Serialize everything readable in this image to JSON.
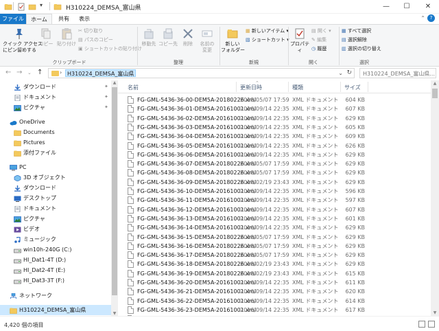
{
  "window": {
    "title": "H310224_DEMSA_富山県",
    "colors": {
      "accent": "#1979ca",
      "folder": "#f3c95c",
      "selection": "#cce8ff"
    }
  },
  "ribbon": {
    "tabs": {
      "file": "ファイル",
      "home": "ホーム",
      "share": "共有",
      "view": "表示"
    },
    "clipboard": {
      "pin_quick_access": "クイック アクセス\nにピン留めする",
      "copy": "コピー",
      "paste": "貼り付け",
      "cut": "切り取り",
      "copy_path": "パスのコピー",
      "paste_shortcut": "ショートカットの貼り付け",
      "label": "クリップボード"
    },
    "organize": {
      "move_to": "移動先",
      "copy_to": "コピー先",
      "delete": "削除",
      "rename": "名前の\n変更",
      "label": "整理"
    },
    "new": {
      "new_folder": "新しい\nフォルダー",
      "new_item": "新しいアイテム ▾",
      "easy_access": "ショートカット ▾",
      "label": "新規"
    },
    "open": {
      "properties": "プロパティ",
      "open": "開く ▾",
      "edit": "編集",
      "history": "履歴",
      "label": "開く"
    },
    "select": {
      "select_all": "すべて選択",
      "select_none": "選択解除",
      "invert": "選択の切り替え",
      "label": "選択"
    }
  },
  "address": {
    "path": "H310224_DEMSA_富山県",
    "search_placeholder": "H310224_DEMSA_富山県..."
  },
  "nav": {
    "items": [
      {
        "label": "ダウンロード",
        "icon": "download-icon",
        "pinned": true
      },
      {
        "label": "ドキュメント",
        "icon": "document-icon",
        "pinned": true
      },
      {
        "label": "ピクチャ",
        "icon": "picture-icon",
        "pinned": true
      },
      {
        "label": "OneDrive",
        "icon": "cloud-icon"
      },
      {
        "label": "Documents",
        "icon": "folder-icon"
      },
      {
        "label": "Pictures",
        "icon": "folder-icon"
      },
      {
        "label": "添付ファイル",
        "icon": "folder-icon"
      },
      {
        "label": "PC",
        "icon": "pc-icon"
      },
      {
        "label": "3D オブジェクト",
        "icon": "3d-objects-icon"
      },
      {
        "label": "ダウンロード",
        "icon": "download-icon"
      },
      {
        "label": "デスクトップ",
        "icon": "desktop-icon"
      },
      {
        "label": "ドキュメント",
        "icon": "document-icon"
      },
      {
        "label": "ピクチャ",
        "icon": "picture-icon"
      },
      {
        "label": "ビデオ",
        "icon": "video-icon"
      },
      {
        "label": "ミュージック",
        "icon": "music-icon"
      },
      {
        "label": "win10h-240G (C:)",
        "icon": "drive-icon"
      },
      {
        "label": "HI_Dat1-4T (D:)",
        "icon": "drive-icon"
      },
      {
        "label": "HI_Dat2-4T (E:)",
        "icon": "drive-icon"
      },
      {
        "label": "HI_Dat3-3T (F:)",
        "icon": "drive-icon"
      },
      {
        "label": "ネットワーク",
        "icon": "network-icon"
      },
      {
        "label": "H310224_DEMSA_富山県",
        "icon": "folder-icon",
        "selected": true
      }
    ]
  },
  "list": {
    "columns": {
      "name": "名前",
      "date": "更新日時",
      "type": "種類",
      "size": "サイズ"
    },
    "rows": [
      {
        "name": "FG-GML-5436-36-00-DEM5A-20180226.xml",
        "date": "2018/05/07 17:59",
        "type": "XML ドキュメント",
        "size": "604 KB"
      },
      {
        "name": "FG-GML-5436-36-01-DEM5A-20161001.xml",
        "date": "2016/09/14 22:35",
        "type": "XML ドキュメント",
        "size": "607 KB"
      },
      {
        "name": "FG-GML-5436-36-02-DEM5A-20161001.xml",
        "date": "2016/09/14 22:35",
        "type": "XML ドキュメント",
        "size": "629 KB"
      },
      {
        "name": "FG-GML-5436-36-03-DEM5A-20161001.xml",
        "date": "2016/09/14 22:35",
        "type": "XML ドキュメント",
        "size": "605 KB"
      },
      {
        "name": "FG-GML-5436-36-04-DEM5A-20161001.xml",
        "date": "2016/09/14 22:35",
        "type": "XML ドキュメント",
        "size": "609 KB"
      },
      {
        "name": "FG-GML-5436-36-05-DEM5A-20161001.xml",
        "date": "2016/09/14 22:35",
        "type": "XML ドキュメント",
        "size": "626 KB"
      },
      {
        "name": "FG-GML-5436-36-06-DEM5A-20161001.xml",
        "date": "2016/09/14 22:35",
        "type": "XML ドキュメント",
        "size": "629 KB"
      },
      {
        "name": "FG-GML-5436-36-07-DEM5A-20180226.xml",
        "date": "2018/05/07 17:59",
        "type": "XML ドキュメント",
        "size": "629 KB"
      },
      {
        "name": "FG-GML-5436-36-08-DEM5A-20180226.xml",
        "date": "2018/05/07 17:59",
        "type": "XML ドキュメント",
        "size": "629 KB"
      },
      {
        "name": "FG-GML-5436-36-09-DEM5A-20180226.xml",
        "date": "2018/02/19 23:43",
        "type": "XML ドキュメント",
        "size": "629 KB"
      },
      {
        "name": "FG-GML-5436-36-10-DEM5A-20161001.xml",
        "date": "2016/09/14 22:35",
        "type": "XML ドキュメント",
        "size": "596 KB"
      },
      {
        "name": "FG-GML-5436-36-11-DEM5A-20161001.xml",
        "date": "2016/09/14 22:35",
        "type": "XML ドキュメント",
        "size": "597 KB"
      },
      {
        "name": "FG-GML-5436-36-12-DEM5A-20161001.xml",
        "date": "2016/09/14 22:35",
        "type": "XML ドキュメント",
        "size": "607 KB"
      },
      {
        "name": "FG-GML-5436-36-13-DEM5A-20161001.xml",
        "date": "2016/09/14 22:35",
        "type": "XML ドキュメント",
        "size": "601 KB"
      },
      {
        "name": "FG-GML-5436-36-14-DEM5A-20161001.xml",
        "date": "2016/09/14 22:35",
        "type": "XML ドキュメント",
        "size": "629 KB"
      },
      {
        "name": "FG-GML-5436-36-15-DEM5A-20180226.xml",
        "date": "2018/05/07 17:59",
        "type": "XML ドキュメント",
        "size": "629 KB"
      },
      {
        "name": "FG-GML-5436-36-16-DEM5A-20180226.xml",
        "date": "2018/05/07 17:59",
        "type": "XML ドキュメント",
        "size": "629 KB"
      },
      {
        "name": "FG-GML-5436-36-17-DEM5A-20180226.xml",
        "date": "2018/05/07 17:59",
        "type": "XML ドキュメント",
        "size": "629 KB"
      },
      {
        "name": "FG-GML-5436-36-18-DEM5A-20180226.xml",
        "date": "2018/02/19 23:43",
        "type": "XML ドキュメント",
        "size": "629 KB"
      },
      {
        "name": "FG-GML-5436-36-19-DEM5A-20180226.xml",
        "date": "2018/02/19 23:43",
        "type": "XML ドキュメント",
        "size": "615 KB"
      },
      {
        "name": "FG-GML-5436-36-20-DEM5A-20161001.xml",
        "date": "2016/09/14 22:35",
        "type": "XML ドキュメント",
        "size": "611 KB"
      },
      {
        "name": "FG-GML-5436-36-21-DEM5A-20161001.xml",
        "date": "2016/09/14 22:35",
        "type": "XML ドキュメント",
        "size": "620 KB"
      },
      {
        "name": "FG-GML-5436-36-22-DEM5A-20161001.xml",
        "date": "2016/09/14 22:35",
        "type": "XML ドキュメント",
        "size": "614 KB"
      },
      {
        "name": "FG-GML-5436-36-23-DEM5A-20161001.xml",
        "date": "2016/09/14 22:35",
        "type": "XML ドキュメント",
        "size": "617 KB"
      },
      {
        "name": "FG-GML-5436-36-24-DEM5A-20180226.xml",
        "date": "2018/05/07 17:59",
        "type": "XML ドキュメント",
        "size": "629 KB"
      }
    ]
  },
  "status": {
    "count": "4,420 個の項目"
  }
}
